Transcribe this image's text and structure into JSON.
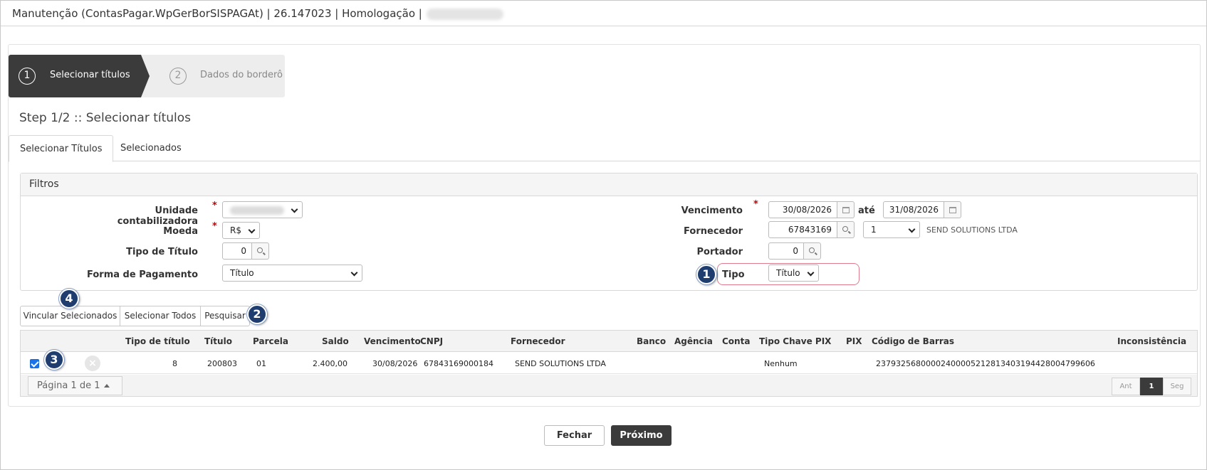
{
  "titlebar": {
    "text": "Manutenção (ContasPagar.WpGerBorSISPAGAt) | 26.147023 | Homologação |"
  },
  "wizard": {
    "step1": {
      "number": "1",
      "label": "Selecionar títulos"
    },
    "step2": {
      "number": "2",
      "label": "Dados do borderô"
    }
  },
  "step_title": "Step 1/2 :: Selecionar títulos",
  "tabs": [
    {
      "label": "Selecionar Títulos"
    },
    {
      "label": "Selecionados"
    }
  ],
  "filters": {
    "header": "Filtros",
    "unidade_label": "Unidade contabilizadora",
    "moeda_label": "Moeda",
    "moeda_value": "R$",
    "tipo_titulo_label": "Tipo de Título",
    "tipo_titulo_value": "0",
    "forma_pagamento_label": "Forma de Pagamento",
    "forma_pagamento_value": "Título",
    "vencimento_label": "Vencimento",
    "vencimento_from": "30/08/2026",
    "ate_label": "até",
    "vencimento_to": "31/08/2026",
    "fornecedor_label": "Fornecedor",
    "fornecedor_code": "67843169",
    "fornecedor_loja": "1",
    "fornecedor_name": "SEND SOLUTIONS LTDA",
    "portador_label": "Portador",
    "portador_value": "0",
    "tipo_label": "Tipo",
    "tipo_value": "Título",
    "required_mark": "*"
  },
  "actions": {
    "vincular": "Vincular Selecionados",
    "selecionar_todos": "Selecionar Todos",
    "pesquisar": "Pesquisar"
  },
  "badges": {
    "b1": "1",
    "b2": "2",
    "b3": "3",
    "b4": "4"
  },
  "grid": {
    "columns": [
      "Tipo de título",
      "Título",
      "Parcela",
      "Saldo",
      "Vencimento",
      "CNPJ",
      "Fornecedor",
      "Banco",
      "Agência",
      "Conta",
      "Tipo Chave PIX",
      "PIX",
      "Código de Barras",
      "Inconsistência"
    ],
    "rows": [
      {
        "tipo_titulo": "8",
        "titulo": "200803",
        "parcela": "01",
        "saldo": "2.400,00",
        "vencimento": "30/08/2026",
        "cnpj": "67843169000184",
        "fornecedor": "SEND SOLUTIONS LTDA",
        "banco": "",
        "agencia": "",
        "conta": "",
        "tipo_chave_pix": "Nenhum",
        "pix": "",
        "codigo_barras": "23793256800002400005212813403194428004799606",
        "inconsistencia": "",
        "checked": true,
        "remove_glyph": "×"
      }
    ],
    "pager": {
      "label": "Página 1 de 1",
      "prev": "Ant",
      "current": "1",
      "next": "Seg"
    }
  },
  "footer": {
    "fechar": "Fechar",
    "proximo": "Próximo"
  },
  "colors": {
    "dark": "#3b3b3b",
    "badge": "#1f3d6e",
    "checkbox": "#1a73e8",
    "required": "#cc0000",
    "highlight": "#e07a8e"
  },
  "icons": [
    "search-icon",
    "calendar-icon",
    "chevron-down-icon",
    "close-icon",
    "caret-up-icon"
  ]
}
